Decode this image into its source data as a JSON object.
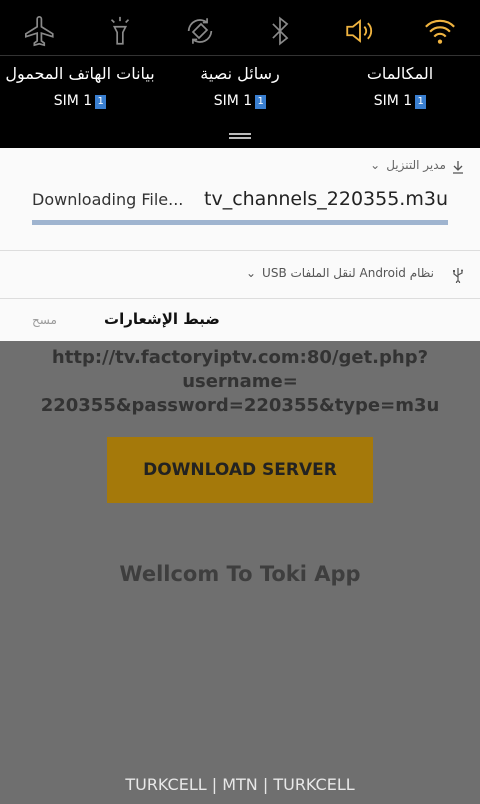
{
  "quick_settings": [
    {
      "name": "airplane-icon",
      "active": false
    },
    {
      "name": "flashlight-icon",
      "active": false
    },
    {
      "name": "auto-rotate-icon",
      "active": false
    },
    {
      "name": "bluetooth-icon",
      "active": false
    },
    {
      "name": "sound-icon",
      "active": true
    },
    {
      "name": "wifi-icon",
      "active": true
    }
  ],
  "colors": {
    "active_icon": "#f0b440",
    "inactive_icon": "#8a8a8a",
    "sim_badge": "#3a7fd0",
    "button": "#a5790a"
  },
  "sim_settings": {
    "calls": {
      "title": "المكالمات",
      "sim": "SIM 1",
      "num": "1"
    },
    "sms": {
      "title": "رسائل نصية",
      "sim": "SIM 1",
      "num": "1"
    },
    "mobile_data": {
      "title": "بيانات الهاتف المحمول",
      "sim": "SIM 1",
      "num": "1"
    }
  },
  "download_notification": {
    "app_name": "مدير التنزيل",
    "status": "Downloading File...",
    "filename": "tv_channels_220355.m3u",
    "progress": 1.0
  },
  "usb_notification": {
    "text": "نظام Android لنقل الملفات USB"
  },
  "notification_controls": {
    "clear": "مسح",
    "settings": "ضبط الإشعارات"
  },
  "app": {
    "url_line1": "http://tv.factoryiptv.com:80/get.php?username=",
    "url_line2": "220355&password=220355&type=m3u",
    "download_button": "DOWNLOAD SERVER",
    "welcome": "Wellcom To Toki App",
    "carriers": "TURKCELL | MTN | TURKCELL"
  }
}
